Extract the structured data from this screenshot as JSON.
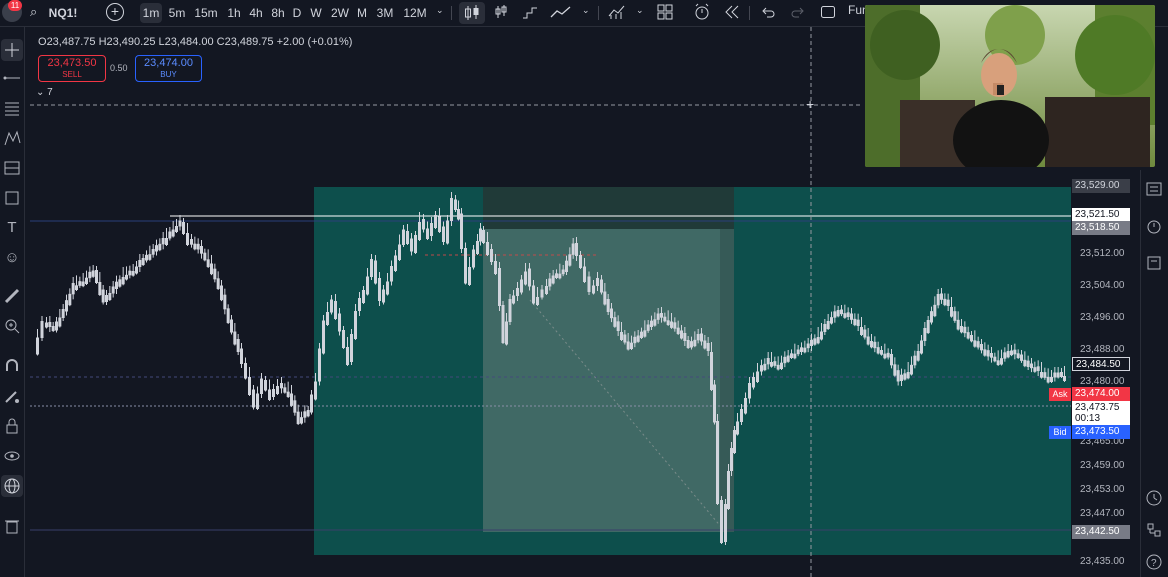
{
  "topbar": {
    "notifications": "11",
    "symbol": "NQ1!",
    "timeframes": [
      "1m",
      "5m",
      "15m",
      "1h",
      "4h",
      "8h",
      "D",
      "W",
      "2W",
      "M",
      "3M",
      "12M"
    ],
    "active_timeframe": "1m",
    "fund_label": "Fun"
  },
  "legend": {
    "o_label": "O",
    "o_value": "23,487.75",
    "h_label": "H",
    "h_value": "23,490.25",
    "l_label": "L",
    "l_value": "23,484.00",
    "c_label": "C",
    "c_value": "23,489.75",
    "change": "+2.00 (+0.01%)"
  },
  "trade": {
    "sell_price": "23,473.50",
    "sell_label": "SELL",
    "spread": "0.50",
    "buy_price": "23,474.00",
    "buy_label": "BUY"
  },
  "indicators_collapse": {
    "icon": "chevron-down-icon",
    "count": "7"
  },
  "price_axis": {
    "labels": [
      "23,512.00",
      "23,504.00",
      "23,496.00",
      "23,488.00",
      "23,480.00",
      "23,465.00",
      "23,459.00",
      "23,453.00",
      "23,447.00",
      "23,435.00"
    ],
    "tag_top": "23,529.00",
    "tag_line": "23,521.50",
    "tag_zone": "23,518.50",
    "tag_last": "23,484.50",
    "ask_label": "Ask",
    "ask_price": "23,474.00",
    "current_price": "23,473.75",
    "countdown": "00:13",
    "bid_label": "Bid",
    "bid_price": "23,473.50",
    "tag_bottom": "23,442.50"
  },
  "colors": {
    "background": "#131722",
    "teal_zone": "#0e4d4d",
    "sell": "#f23645",
    "buy": "#2962ff",
    "candle": "#d1d4dc"
  }
}
